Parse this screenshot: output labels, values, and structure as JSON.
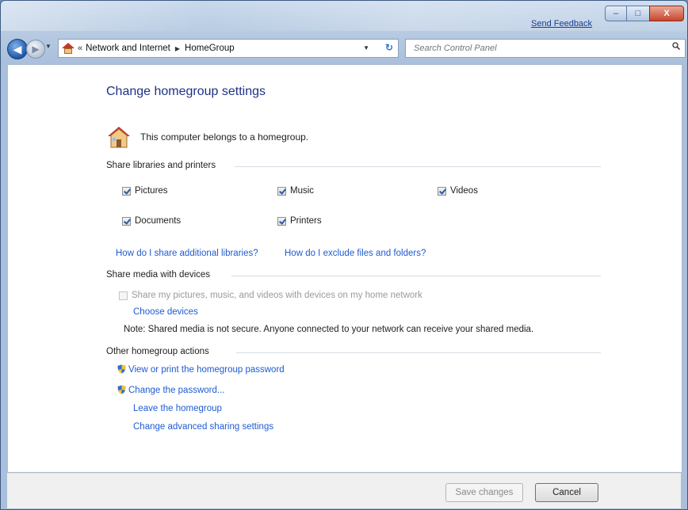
{
  "titlebar": {
    "send_feedback": "Send Feedback",
    "minimize_glyph": "–",
    "maximize_glyph": "□",
    "close_glyph": "X"
  },
  "navbar": {
    "back_glyph": "◀",
    "forward_glyph": "▶",
    "crumb_lead": "«",
    "breadcrumbs": [
      "Network and Internet",
      "HomeGroup"
    ],
    "crumb_separator": "▶",
    "refresh_glyph": "↻",
    "search_placeholder": "Search Control Panel"
  },
  "main": {
    "title": "Change homegroup settings",
    "belongs": "This computer belongs to a homegroup.",
    "share_libraries": {
      "heading": "Share libraries and printers",
      "items": [
        {
          "label": "Pictures",
          "checked": true
        },
        {
          "label": "Music",
          "checked": true
        },
        {
          "label": "Videos",
          "checked": true
        },
        {
          "label": "Documents",
          "checked": true
        },
        {
          "label": "Printers",
          "checked": true
        }
      ],
      "link_additional": "How do I share additional libraries?",
      "link_exclude": "How do I exclude files and folders?"
    },
    "share_media": {
      "heading": "Share media with devices",
      "checkbox_label": "Share my pictures, music, and videos with devices on my home network",
      "checked": false,
      "choose_devices": "Choose devices",
      "note": "Note: Shared media is not secure. Anyone connected to your network can receive your shared media."
    },
    "other_actions": {
      "heading": "Other homegroup actions",
      "view_password": "View or print the homegroup password",
      "change_password": "Change the password...",
      "leave": "Leave the homegroup",
      "advanced": "Change advanced sharing settings"
    }
  },
  "footer": {
    "save": "Save changes",
    "cancel": "Cancel"
  },
  "colors": {
    "link": "#1f5bd1",
    "title": "#1e3287",
    "disabled": "#9a9a9a"
  }
}
